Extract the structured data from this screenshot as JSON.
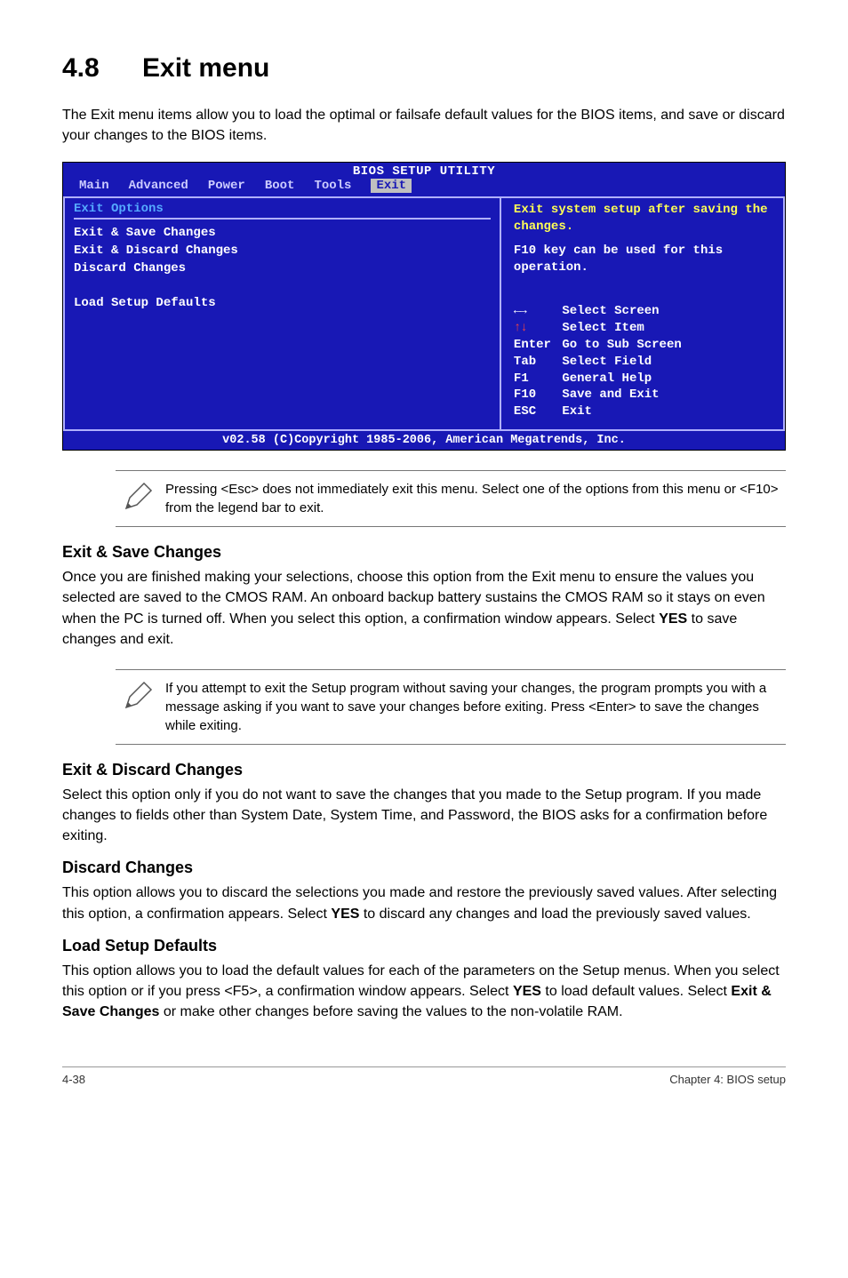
{
  "heading": {
    "number": "4.8",
    "title": "Exit menu"
  },
  "intro": "The Exit menu items allow you to load the optimal or failsafe default values for the BIOS items, and save or discard your changes to the BIOS items.",
  "bios": {
    "title": "BIOS SETUP UTILITY",
    "tabs": [
      "Main",
      "Advanced",
      "Power",
      "Boot",
      "Tools",
      "Exit"
    ],
    "active_tab": "Exit",
    "left_label": "Exit Options",
    "items": [
      "Exit & Save Changes",
      "Exit & Discard Changes",
      "Discard Changes",
      "",
      "Load Setup Defaults"
    ],
    "help": {
      "line1": "Exit system setup after saving the changes.",
      "line2": "F10 key can be used for this operation."
    },
    "keys": [
      {
        "k": "←→",
        "v": "Select Screen"
      },
      {
        "k": "↑↓",
        "v": "Select Item"
      },
      {
        "k": "Enter",
        "v": "Go to Sub Screen"
      },
      {
        "k": "Tab",
        "v": "Select Field"
      },
      {
        "k": "F1",
        "v": "General Help"
      },
      {
        "k": "F10",
        "v": "Save and Exit"
      },
      {
        "k": "ESC",
        "v": "Exit"
      }
    ],
    "footer": "v02.58 (C)Copyright 1985-2006, American Megatrends, Inc."
  },
  "note1": "Pressing <Esc> does not immediately exit this menu. Select one of the options from this menu or <F10> from the legend bar to exit.",
  "sections": {
    "save": {
      "title": "Exit & Save Changes",
      "body_pre": "Once you are finished making your selections, choose this option from the Exit menu to ensure the values you selected are saved to the CMOS RAM. An onboard backup battery sustains the CMOS RAM so it stays on even when the PC is turned off. When you select this option, a confirmation window appears. Select ",
      "bold1": "YES",
      "body_post": " to save changes and exit."
    },
    "note2": "If you attempt to exit the Setup program without saving your changes, the program prompts you with a message asking if you want to save your changes before exiting. Press <Enter> to save the changes while exiting.",
    "discard_exit": {
      "title": "Exit & Discard Changes",
      "body": "Select this option only if you do not want to save the changes that you  made to the Setup program. If you made changes to fields other than System Date, System Time, and Password, the BIOS asks for a confirmation before exiting."
    },
    "discard": {
      "title": "Discard Changes",
      "body_pre": "This option allows you to discard the selections you made and restore the previously saved values. After selecting this option, a confirmation appears. Select ",
      "bold1": "YES",
      "body_post": " to discard any changes and load the previously saved values."
    },
    "load": {
      "title": "Load Setup Defaults",
      "body_pre": "This option allows you to load the default values for each of the parameters on the Setup menus. When you select this option or if you press <F5>, a confirmation window appears. Select ",
      "bold1": "YES",
      "body_mid": " to load default values. Select ",
      "bold2": "Exit & Save Changes",
      "body_post": " or make other changes before saving the values to the non-volatile RAM."
    }
  },
  "footer": {
    "left": "4-38",
    "right": "Chapter 4: BIOS setup"
  }
}
